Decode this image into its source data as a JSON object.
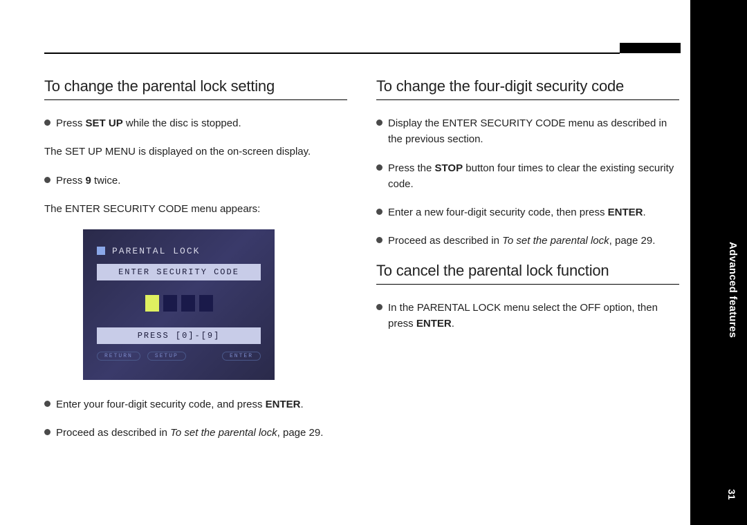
{
  "side": {
    "section_label": "Advanced features",
    "page_number": "31"
  },
  "left": {
    "heading": "To change the parental lock setting",
    "step1_a": "Press ",
    "step1_b": "SET UP",
    "step1_c": " while the disc is stopped.",
    "plain1": "The SET UP MENU is displayed on the on-screen display.",
    "step2_a": "Press ",
    "step2_b": "9",
    "step2_c": " twice.",
    "plain2": "The ENTER SECURITY CODE menu appears:",
    "screenshot": {
      "title": "PARENTAL LOCK",
      "enter_sec": "ENTER SECURITY CODE",
      "press_hint": "PRESS [0]-[9]",
      "soft1": "RETURN",
      "soft2": "SETUP",
      "soft3": "ENTER"
    },
    "step3_a": "Enter your four-digit security code, and press ",
    "step3_b": "ENTER",
    "step3_c": ".",
    "step4_a": "Proceed as described in ",
    "step4_b": "To set the parental lock",
    "step4_c": ", page 29."
  },
  "right": {
    "heading_a": "To change the four-digit security code",
    "step_a1": "Display the ENTER SECURITY CODE menu as described in the previous section.",
    "step_a2_a": "Press the ",
    "step_a2_b": "STOP",
    "step_a2_c": " button four times to clear the existing security code.",
    "step_a3_a": "Enter a new four-digit security code, then press ",
    "step_a3_b": "ENTER",
    "step_a3_c": ".",
    "step_a4_a": "Proceed as described in ",
    "step_a4_b": "To set the parental lock",
    "step_a4_c": ", page 29.",
    "heading_b": "To cancel the parental lock function",
    "step_b1_a": "In the PARENTAL LOCK menu select the OFF option, then press ",
    "step_b1_b": "ENTER",
    "step_b1_c": "."
  }
}
